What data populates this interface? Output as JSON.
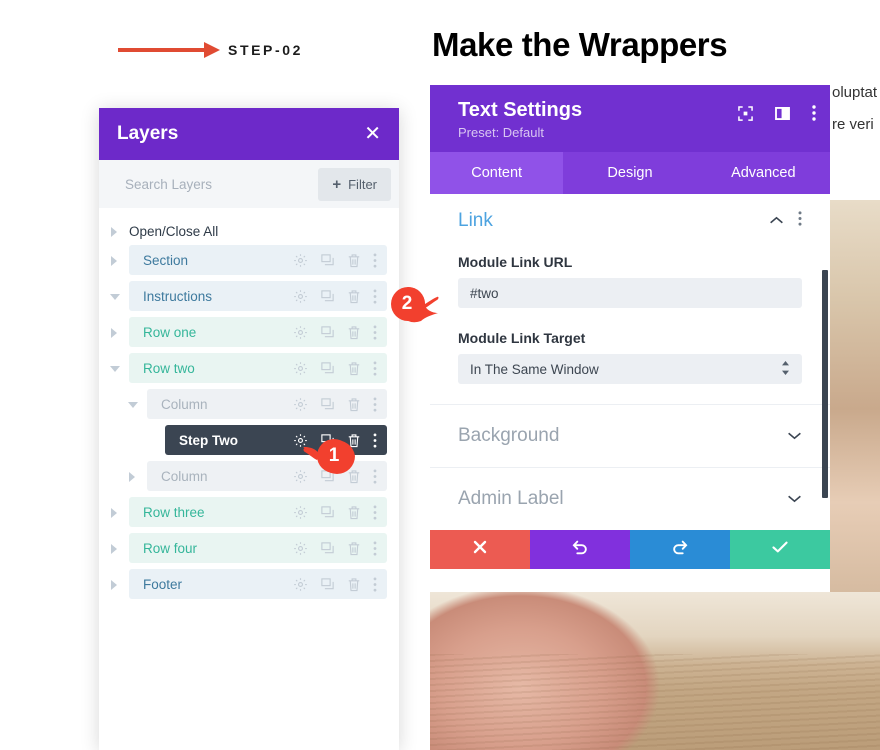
{
  "step": {
    "label": "STEP-02",
    "arrow_icon": "arrow-right-icon",
    "arrow_color": "#e04b33"
  },
  "page_title": "Make the Wrappers",
  "background_text": {
    "line1": "oluptat",
    "line2": "re veri"
  },
  "layers_modal": {
    "title": "Layers",
    "close_label": "✕",
    "search_placeholder": "Search Layers",
    "filter_label": "Filter",
    "filter_plus": "+",
    "open_close_all": "Open/Close All",
    "rows": [
      {
        "name": "Section",
        "type": "section",
        "indent": 0,
        "toggle": "right",
        "selected": false
      },
      {
        "name": "Instructions",
        "type": "section",
        "indent": 0,
        "toggle": "down",
        "selected": false
      },
      {
        "name": "Row one",
        "type": "row",
        "indent": 1,
        "toggle": "right",
        "selected": false
      },
      {
        "name": "Row two",
        "type": "row",
        "indent": 1,
        "toggle": "down",
        "selected": false
      },
      {
        "name": "Column",
        "type": "column",
        "indent": 2,
        "toggle": "down",
        "selected": false
      },
      {
        "name": "Step Two",
        "type": "module",
        "indent": 3,
        "toggle": "none",
        "selected": true
      },
      {
        "name": "Column",
        "type": "column",
        "indent": 2,
        "toggle": "right",
        "selected": false
      },
      {
        "name": "Row three",
        "type": "row",
        "indent": 1,
        "toggle": "right",
        "selected": false
      },
      {
        "name": "Row four",
        "type": "row",
        "indent": 1,
        "toggle": "right",
        "selected": false
      },
      {
        "name": "Footer",
        "type": "section",
        "indent": 0,
        "toggle": "right",
        "selected": false
      }
    ],
    "row_icons": [
      "gear-icon",
      "duplicate-icon",
      "trash-icon",
      "more-vertical-icon"
    ]
  },
  "settings_panel": {
    "title": "Text Settings",
    "preset": "Preset: Default",
    "header_icons": [
      "focus-icon",
      "layout-icon",
      "more-vertical-icon"
    ],
    "tabs": [
      {
        "label": "Content",
        "active": true
      },
      {
        "label": "Design",
        "active": false
      },
      {
        "label": "Advanced",
        "active": false
      }
    ],
    "link_section": {
      "title": "Link",
      "expanded": true,
      "url_label": "Module Link URL",
      "url_value": "#two",
      "target_label": "Module Link Target",
      "target_value": "In The Same Window"
    },
    "collapsed_sections": [
      {
        "title": "Background"
      },
      {
        "title": "Admin Label"
      }
    ],
    "actions": [
      {
        "name": "cancel",
        "icon": "close-icon",
        "color": "#ec5b52"
      },
      {
        "name": "undo",
        "icon": "undo-icon",
        "color": "#8130dd"
      },
      {
        "name": "redo",
        "icon": "redo-icon",
        "color": "#2a8cd6"
      },
      {
        "name": "save",
        "icon": "check-icon",
        "color": "#3cc9a0"
      }
    ],
    "colors": {
      "header": "#7130d0",
      "tabs": "#7f3ddb",
      "tab_active": "#9052e8",
      "link_title": "#4da3e0"
    }
  },
  "callouts": [
    {
      "number": "1",
      "direction": "left"
    },
    {
      "number": "2",
      "direction": "right"
    }
  ]
}
